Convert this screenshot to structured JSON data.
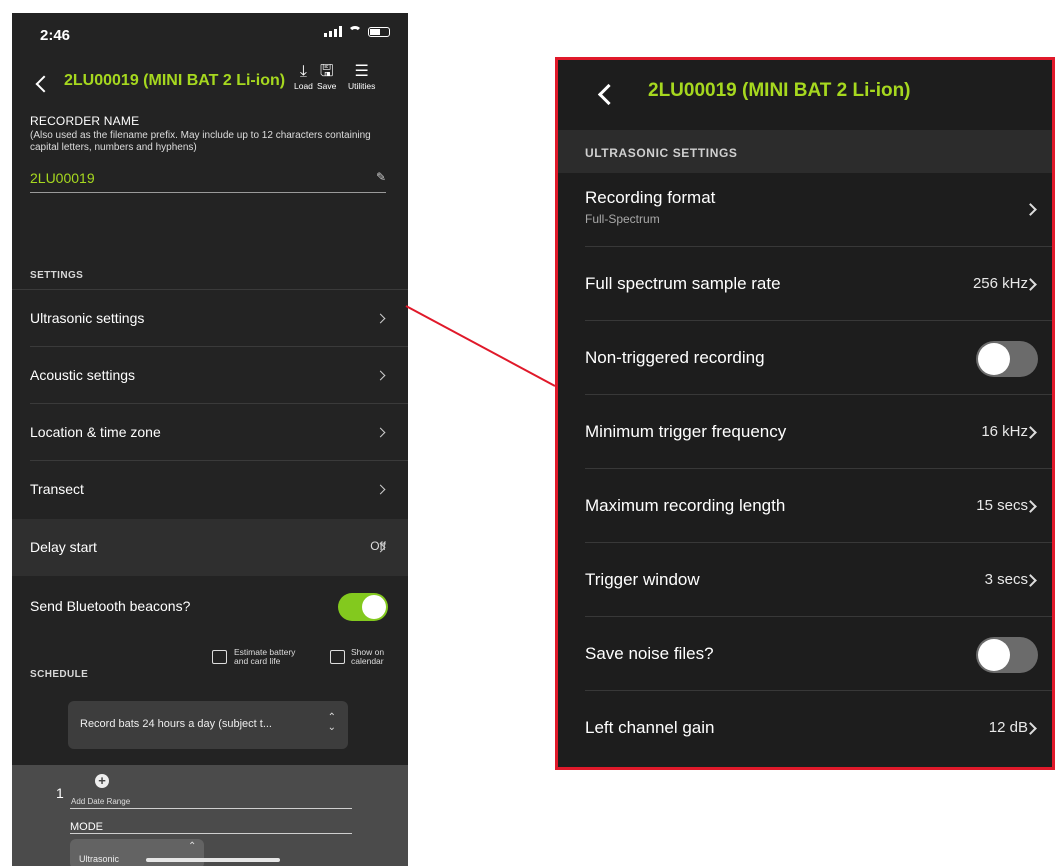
{
  "phone": {
    "status": {
      "time": "2:46"
    },
    "nav": {
      "title": "2LU00019 (MINI BAT 2 Li-ion)",
      "load_label": "Load",
      "save_label": "Save",
      "utilities_label": "Utilities"
    },
    "recorder_name": {
      "label": "RECORDER NAME",
      "help": "(Also used as the filename prefix. May include up to 12 characters containing capital letters, numbers and hyphens)",
      "value": "2LU00019"
    },
    "settings": {
      "header": "SETTINGS",
      "items": [
        {
          "label": "Ultrasonic settings"
        },
        {
          "label": "Acoustic settings"
        },
        {
          "label": "Location & time zone"
        },
        {
          "label": "Transect"
        },
        {
          "label": "Delay start",
          "value": "Off"
        },
        {
          "label": "Send Bluetooth beacons?",
          "toggle": true
        }
      ]
    },
    "schedule": {
      "header": "SCHEDULE",
      "estimate_line1": "Estimate battery",
      "estimate_line2": "and card life",
      "calendar_line1": "Show on",
      "calendar_line2": "calendar",
      "picker_value": "Record bats 24 hours a day (subject t...",
      "range_number": "1",
      "add_date_range": "Add Date Range",
      "mode_label": "MODE",
      "mode_value": "Ultrasonic"
    }
  },
  "zoom": {
    "nav_title": "2LU00019 (MINI BAT 2 Li-ion)",
    "section": "ULTRASONIC SETTINGS",
    "rows": [
      {
        "label": "Recording format",
        "sub": "Full-Spectrum"
      },
      {
        "label": "Full spectrum sample rate",
        "value": "256 kHz"
      },
      {
        "label": "Non-triggered recording",
        "toggle": false
      },
      {
        "label": "Minimum trigger frequency",
        "value": "16 kHz"
      },
      {
        "label": "Maximum recording length",
        "value": "15 secs"
      },
      {
        "label": "Trigger window",
        "value": "3 secs"
      },
      {
        "label": "Save noise files?",
        "toggle": false
      },
      {
        "label": "Left channel gain",
        "value": "12 dB"
      }
    ]
  },
  "colors": {
    "accent_green": "#a6d81f",
    "toggle_on": "#83c91e",
    "highlight_border": "#e0192a",
    "background_dark": "#232323"
  }
}
